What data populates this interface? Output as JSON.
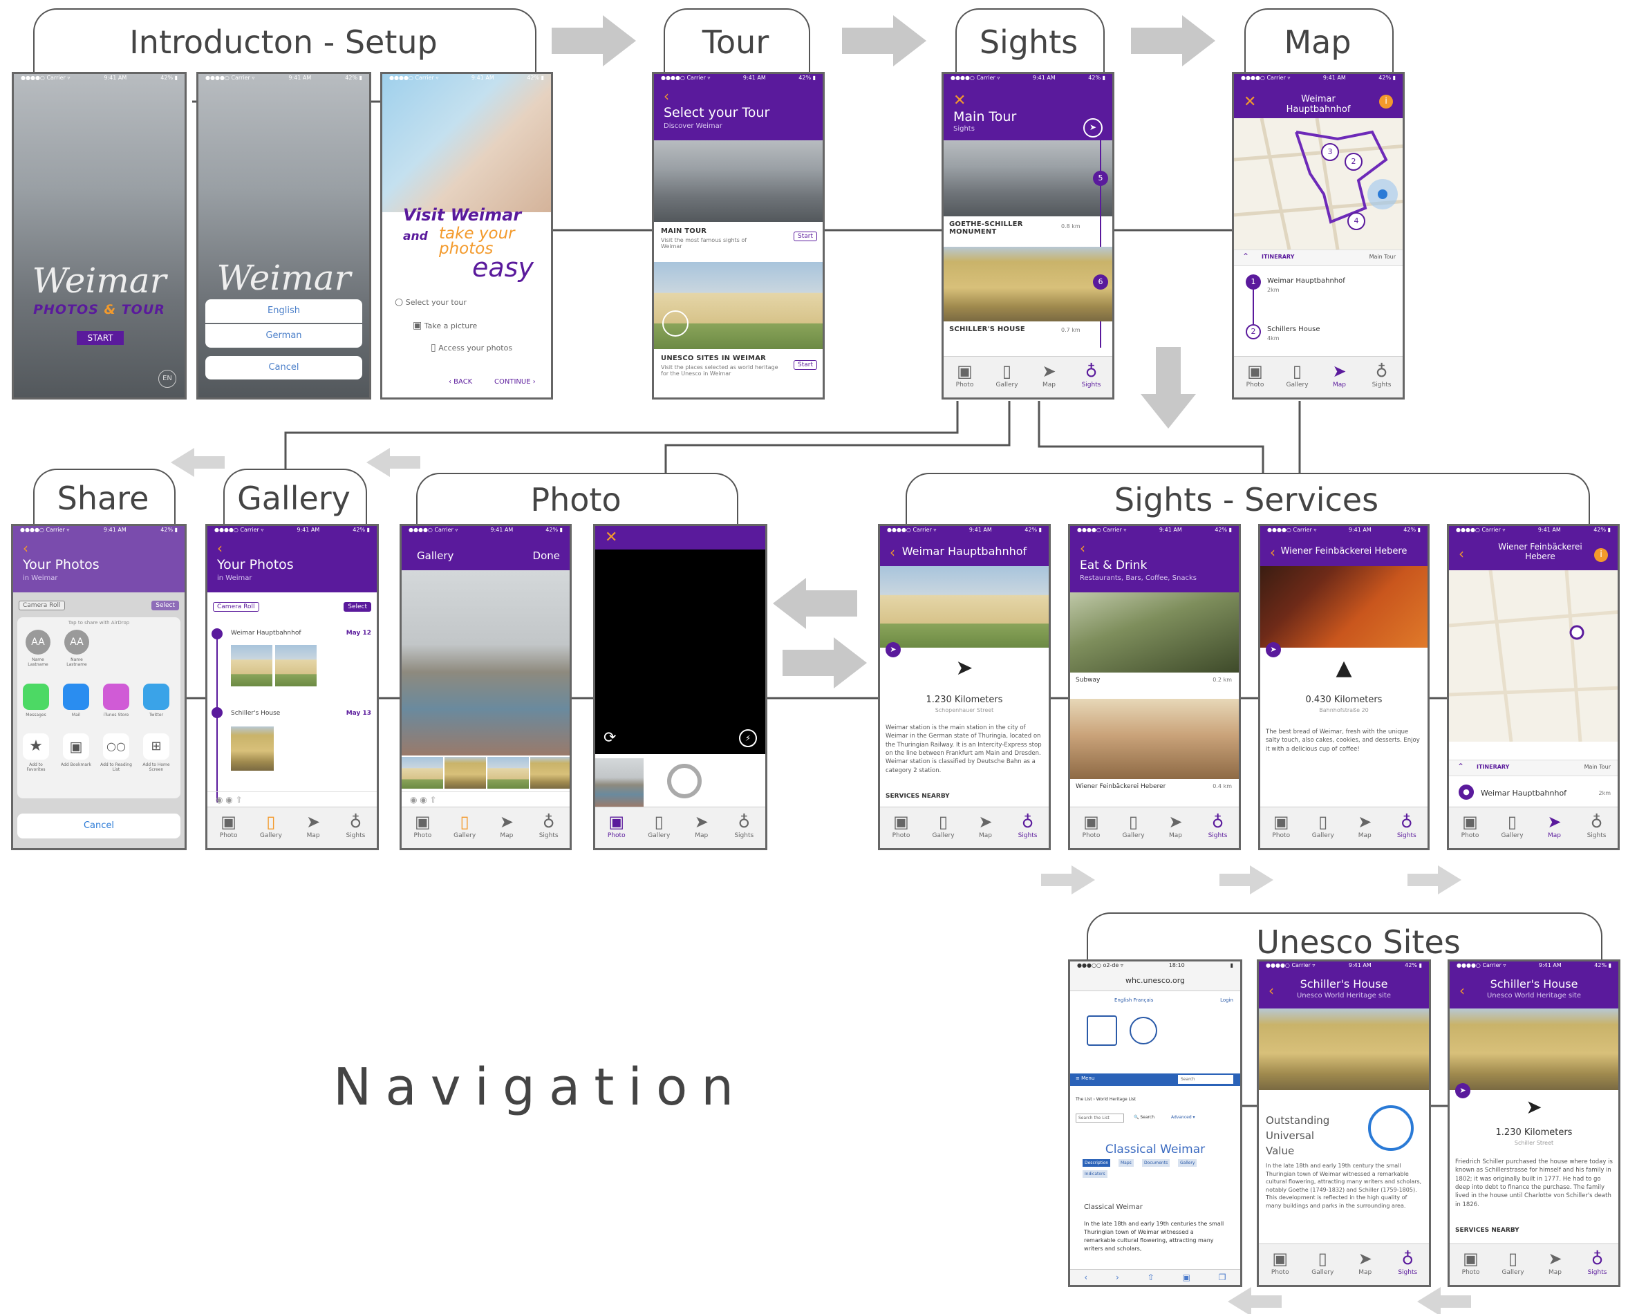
{
  "sections": {
    "intro": "Introducton - Setup",
    "tour": "Tour",
    "sights": "Sights",
    "map": "Map",
    "share": "Share",
    "gallery": "Gallery",
    "photo": "Photo",
    "services": "Sights - Services",
    "unesco": "Unesco Sites"
  },
  "navigation_label": "Navigation",
  "status": {
    "carrier": "●●●●○ Carrier ▿",
    "time": "9:41 AM",
    "battery": "42% ▮"
  },
  "tabs": {
    "photo": "Photo",
    "gallery": "Gallery",
    "map": "Map",
    "sights": "Sights"
  },
  "icons": {
    "photo": "▣",
    "gallery": "▯",
    "map": "➤",
    "sights": "♁"
  },
  "colors": {
    "brand_purple": "#5a1a9c",
    "accent_orange": "#f39a2c",
    "arrow_gray": "#c8c8c8"
  },
  "splash": {
    "title": "Weimar",
    "subtitle": "PHOTOS & TOUR",
    "subtitle_a": "PHOTOS",
    "subtitle_amp": "&",
    "subtitle_b": "TOUR",
    "start": "START",
    "lang_badge": "EN"
  },
  "language_menu": {
    "title": "Weimar",
    "options": [
      "English",
      "German"
    ],
    "cancel": "Cancel"
  },
  "onboarding": {
    "line1": "Visit Weimar",
    "line1_and": "and",
    "line2": "take your",
    "line3": "photos",
    "line4": "easy",
    "steps": [
      "Select your tour",
      "Take a picture",
      "Access your photos"
    ],
    "back": "‹ BACK",
    "continue": "CONTINUE ›"
  },
  "tour_screen": {
    "title": "Select your Tour",
    "subtitle": "Discover Weimar",
    "items": [
      {
        "name": "MAIN TOUR",
        "desc": "Visit the most famous sights of Weimar",
        "action": "Start"
      },
      {
        "name": "UNESCO SITES IN WEIMAR",
        "desc": "Visit the places selected as world heritage for the Unesco in Weimar",
        "action": "Start"
      }
    ]
  },
  "sights_screen": {
    "title": "Main Tour",
    "subtitle": "Sights",
    "close": "✕",
    "items": [
      {
        "name": "GOETHE-SCHILLER MONUMENT",
        "dist": "0.8 km"
      },
      {
        "name": "SCHILLER'S HOUSE",
        "dist": "0.7 km"
      }
    ],
    "markers": [
      "5",
      "6"
    ]
  },
  "map_screen": {
    "title": "Weimar Hauptbahnhof",
    "close": "✕",
    "info": "i",
    "itinerary": "ITINERARY",
    "tour": "Main Tour",
    "stops": [
      {
        "num": "1",
        "name": "Weimar Hauptbahnhof",
        "dist": "2km"
      },
      {
        "num": "2",
        "name": "Schillers House",
        "dist": "4km"
      }
    ],
    "pins": [
      "1",
      "3",
      "2",
      "4"
    ]
  },
  "share_screen": {
    "title": "Your Photos",
    "subtitle": "in Weimar",
    "camera_roll": "Camera Roll",
    "select": "Select",
    "airdrop_hint": "Tap to share with AirDrop",
    "contacts": [
      {
        "initials": "AA",
        "name": "Name Lastname"
      },
      {
        "initials": "AA",
        "name": "Name Lastname"
      }
    ],
    "apps": [
      "Messages",
      "Mail",
      "iTunes Store",
      "Twitter"
    ],
    "actions": [
      "Add to Favorites",
      "Add Bookmark",
      "Add to Reading List",
      "Add to Home Screen"
    ],
    "cancel": "Cancel"
  },
  "gallery_screen": {
    "title": "Your Photos",
    "subtitle": "in Weimar",
    "camera_roll": "Camera Roll",
    "select": "Select",
    "groups": [
      {
        "place": "Weimar Hauptbahnhof",
        "date": "May 12"
      },
      {
        "place": "Schiller's House",
        "date": "May 13"
      }
    ]
  },
  "photo_screen": {
    "left": "Gallery",
    "right": "Done"
  },
  "camera_screen": {
    "close": "✕"
  },
  "hbf_screen": {
    "title": "Weimar Hauptbahnhof",
    "distance": "1.230 Kilometers",
    "street": "Schopenhauer Street",
    "desc": "Weimar station is the main station in the city of Weimar in the German state of Thuringia, located on the Thuringian Railway. It is an Intercity-Express stop on the line between Frankfurt am Main and Dresden. Weimar station is classified by Deutsche Bahn as a category 2 station.",
    "services": "SERVICES NEARBY"
  },
  "eat_screen": {
    "title": "Eat & Drink",
    "subtitle": "Restaurants, Bars, Coffee, Snacks",
    "items": [
      {
        "name": "Subway",
        "dist": "0.2 km"
      },
      {
        "name": "Wiener Feinbäckerei Heberer",
        "dist": "0.4 km"
      }
    ]
  },
  "bakery_screen": {
    "title": "Wiener Feinbäckerei Hebere",
    "distance": "0.430 Kilometers",
    "street": "Bahnhofstraße 20",
    "desc": "The best bread of Weimar, fresh with the unique salty touch, also cakes, cookies, and desserts. Enjoy it with a delicious cup of coffee!"
  },
  "bakery_map_screen": {
    "title": "Wiener Feinbäckerei Hebere",
    "itinerary": "ITINERARY",
    "tour": "Main Tour",
    "stop": "Weimar Hauptbahnhof",
    "stop_dist": "2km"
  },
  "web_screen": {
    "url": "whc.unesco.org",
    "time": "18:10",
    "carrier": "●●●○○ o2-de ▿",
    "lang": "English  Français",
    "login": "Login",
    "menu": "≡ Menu",
    "search": "Search",
    "crumbs": "The List › World Heritage List",
    "search_list": "Search the List",
    "search_btn": "🔍 Search",
    "advanced": "Advanced ▾",
    "heading": "Classical Weimar",
    "tabs": [
      "Description",
      "Maps",
      "Documents",
      "Gallery",
      "Indicators"
    ],
    "section": "Classical Weimar",
    "body": "In the late 18th and early 19th centuries the small Thuringian town of Weimar witnessed a remarkable cultural flowering, attracting many writers and scholars,"
  },
  "schiller_a": {
    "title": "Schiller's House",
    "subtitle": "Unesco World Heritage site",
    "ouv": "Outstanding Universal Value",
    "desc": "In the late 18th and early 19th century the small Thuringian town of Weimar witnessed a remarkable cultural flowering, attracting many writers and scholars, notably Goethe (1749-1832) and Schiller (1759-1805). This development is reflected in the high quality of many buildings and parks in the surrounding area."
  },
  "schiller_b": {
    "title": "Schiller's House",
    "subtitle": "Unesco World Heritage site",
    "distance": "1.230 Kilometers",
    "street": "Schiller Street",
    "desc": "Friedrich Schiller purchased the house where today is known as Schillerstrasse for himself and his family in 1802; it was originally built in 1777. He had to go deep into debt to finance the purchase. The family lived in the house until Charlotte von Schiller's death in 1826.",
    "services": "SERVICES NEARBY"
  }
}
